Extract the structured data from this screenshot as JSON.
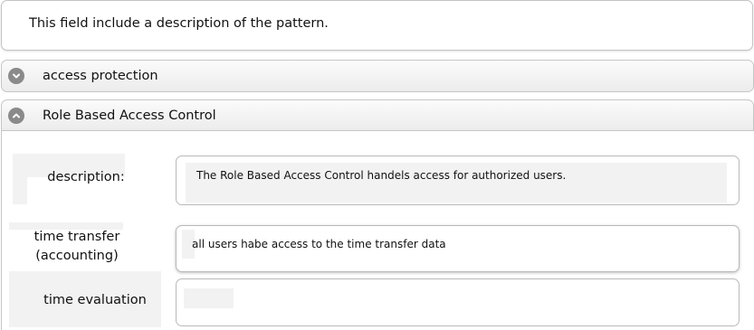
{
  "pattern_description": "This field include a description of the pattern.",
  "accordion": {
    "collapsed_section": {
      "label": "access protection",
      "icon": "chevron-down-icon"
    },
    "expanded_section": {
      "label": "Role Based Access Control",
      "icon": "chevron-up-icon",
      "fields": {
        "description": {
          "label": "description:",
          "value": "The Role Based Access Control handels access for authorized users."
        },
        "time_transfer": {
          "label_line1": "time transfer",
          "label_line2": "(accounting)",
          "value": "all users habe access to the time transfer data"
        },
        "time_evaluation": {
          "label": "time evaluation",
          "value": ""
        }
      }
    }
  },
  "colors": {
    "border": "#c4c4c4",
    "icon": "#8a8a8a",
    "header_bg": "#ececec"
  }
}
